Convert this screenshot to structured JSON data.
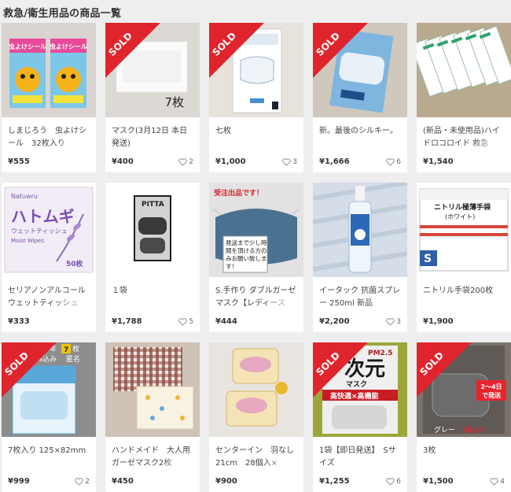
{
  "page": {
    "title": "救急/衛生用品の商品一覧"
  },
  "sold_label": "SOLD",
  "items": [
    {
      "title": "しまじろう　虫よけシール　32枚入り",
      "price": "¥555",
      "likes": "",
      "sold": false,
      "overlay": ""
    },
    {
      "title": "マスク(3月12日 本日発送)",
      "price": "¥400",
      "likes": "2",
      "sold": true,
      "overlay": "7枚"
    },
    {
      "title": "七枚",
      "price": "¥1,000",
      "likes": "3",
      "sold": true,
      "overlay": ""
    },
    {
      "title": "新。最後のシルキー。",
      "price": "¥1,666",
      "likes": "6",
      "sold": true,
      "overlay": ""
    },
    {
      "title": "(新品・未使用品)ハイドロコロイド 救急",
      "price": "¥1,540",
      "likes": "",
      "sold": false,
      "overlay": ""
    },
    {
      "title": "セリアノンアルコールウェットティッシュ",
      "price": "¥333",
      "likes": "",
      "sold": false,
      "overlay": ""
    },
    {
      "title": "１袋",
      "price": "¥1,788",
      "likes": "5",
      "sold": false,
      "overlay": ""
    },
    {
      "title": "S.手作り ダブルガーゼマスク【レディース",
      "price": "¥444",
      "likes": "",
      "sold": false,
      "overlay": ""
    },
    {
      "title": "イータック 抗菌スプレー 250ml 新品",
      "price": "¥2,200",
      "likes": "3",
      "sold": false,
      "overlay": ""
    },
    {
      "title": "ニトリル手袋200枚",
      "price": "¥1,900",
      "likes": "",
      "sold": false,
      "overlay": ""
    },
    {
      "title": "7枚入り 125×82mm",
      "price": "¥999",
      "likes": "2",
      "sold": true,
      "overlay": ""
    },
    {
      "title": "ハンドメイド　大人用ガーゼマスク2枚",
      "price": "¥450",
      "likes": "",
      "sold": false,
      "overlay": ""
    },
    {
      "title": "センターイン　羽なし21cm　28個入×",
      "price": "¥900",
      "likes": "",
      "sold": false,
      "overlay": ""
    },
    {
      "title": "1袋【即日発送】　Sサイズ",
      "price": "¥1,255",
      "likes": "6",
      "sold": true,
      "overlay": ""
    },
    {
      "title": "3枚",
      "price": "¥1,500",
      "likes": "4",
      "sold": true,
      "overlay": ""
    }
  ],
  "thumb_text": {
    "t0_label": "虫よけシール",
    "t5_brand": "Natuwru",
    "t5_name": "ハトムギ",
    "t5_sub": "ウェットティッシュ",
    "t5_en": "Moist Wipes",
    "t5_count": "50枚",
    "t6_brand": "PITTA",
    "t7_banner": "受注出品です！",
    "t7_note1": "発送まで少し時",
    "t7_note2": "間を頂ける方の",
    "t7_note3": "みお願い致しま",
    "t7_note4": "す！",
    "t9_line1": "ニトリル極薄手袋",
    "t9_line2": "(ホワイト)",
    "t9_size": "S",
    "t10_top1": "年低学年",
    "t10_top2": "7",
    "t10_top3": "枚",
    "t10_top4": "送料込み",
    "t10_top5": "匿名",
    "t13_top": "PM2.5",
    "t13_name": "次元",
    "t13_mask": "マスク",
    "t13_sub": "高快適×高機能",
    "t14_ship1": "2〜4日",
    "t14_ship2": "で発送",
    "t14_color": "グレー",
    "t14_count": "3枚入り"
  },
  "colors": {
    "sold_red": "#e0242d",
    "price": "#333333",
    "bg": "#eeeeee"
  }
}
